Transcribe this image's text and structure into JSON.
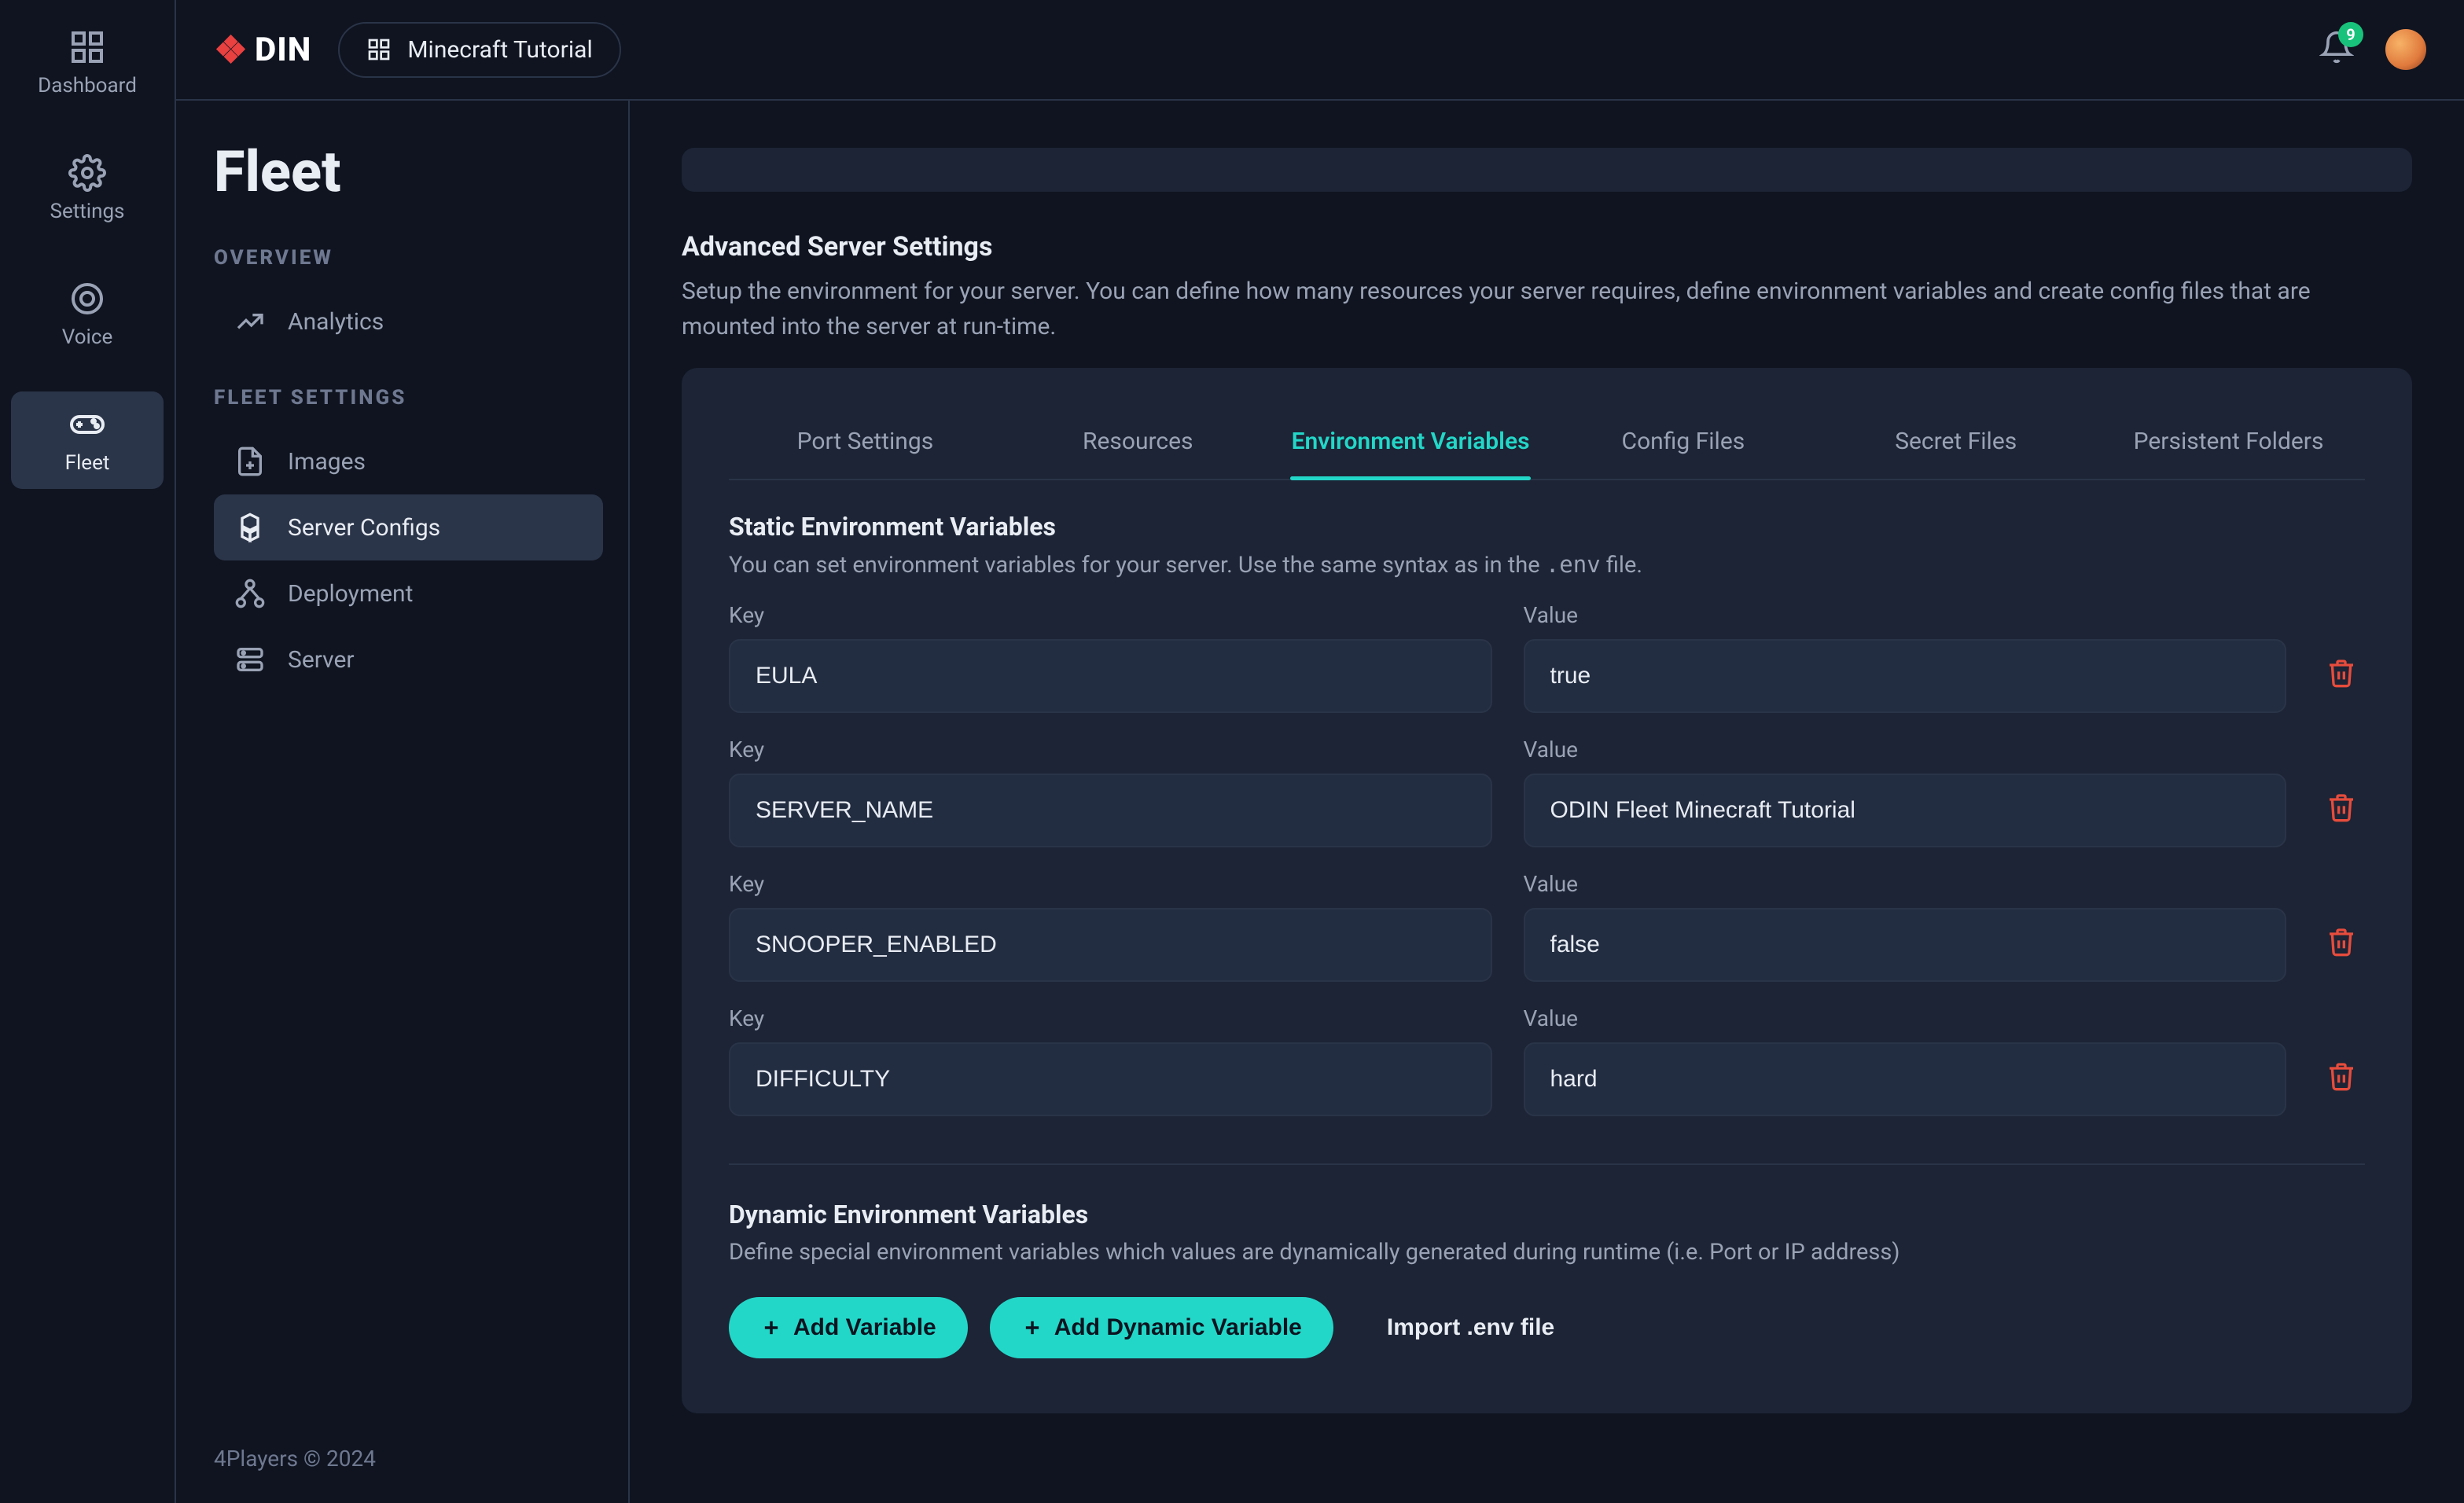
{
  "brand": "DIN",
  "chip_label": "Minecraft Tutorial",
  "notification_count": "9",
  "rail": [
    {
      "id": "dashboard",
      "label": "Dashboard"
    },
    {
      "id": "settings",
      "label": "Settings"
    },
    {
      "id": "voice",
      "label": "Voice"
    },
    {
      "id": "fleet",
      "label": "Fleet"
    }
  ],
  "sidebar": {
    "title": "Fleet",
    "group_overview": "OVERVIEW",
    "group_fleet": "FLEET SETTINGS",
    "items": {
      "analytics": "Analytics",
      "images": "Images",
      "server_configs": "Server Configs",
      "deployment": "Deployment",
      "server": "Server"
    }
  },
  "footer": "4Players © 2024",
  "advanced": {
    "title": "Advanced Server Settings",
    "desc": "Setup the environment for your server. You can define how many resources your server requires, define environment variables and create config files that are mounted into the server at run-time."
  },
  "tabs": {
    "port": "Port Settings",
    "resources": "Resources",
    "env": "Environment Variables",
    "config": "Config Files",
    "secret": "Secret Files",
    "persistent": "Persistent Folders"
  },
  "static": {
    "title": "Static Environment Variables",
    "desc_pre": "You can set environment variables for your server. Use the same syntax as in the ",
    "desc_code": ".env",
    "desc_post": " file.",
    "key_label": "Key",
    "value_label": "Value"
  },
  "vars": [
    {
      "key": "EULA",
      "value": "true"
    },
    {
      "key": "SERVER_NAME",
      "value": "ODIN Fleet Minecraft Tutorial"
    },
    {
      "key": "SNOOPER_ENABLED",
      "value": "false"
    },
    {
      "key": "DIFFICULTY",
      "value": "hard"
    }
  ],
  "dynamic": {
    "title": "Dynamic Environment Variables",
    "desc": "Define special environment variables which values are dynamically generated during runtime (i.e. Port or IP address)"
  },
  "buttons": {
    "add_var": "Add Variable",
    "add_dyn": "Add Dynamic Variable",
    "import": "Import .env file"
  }
}
